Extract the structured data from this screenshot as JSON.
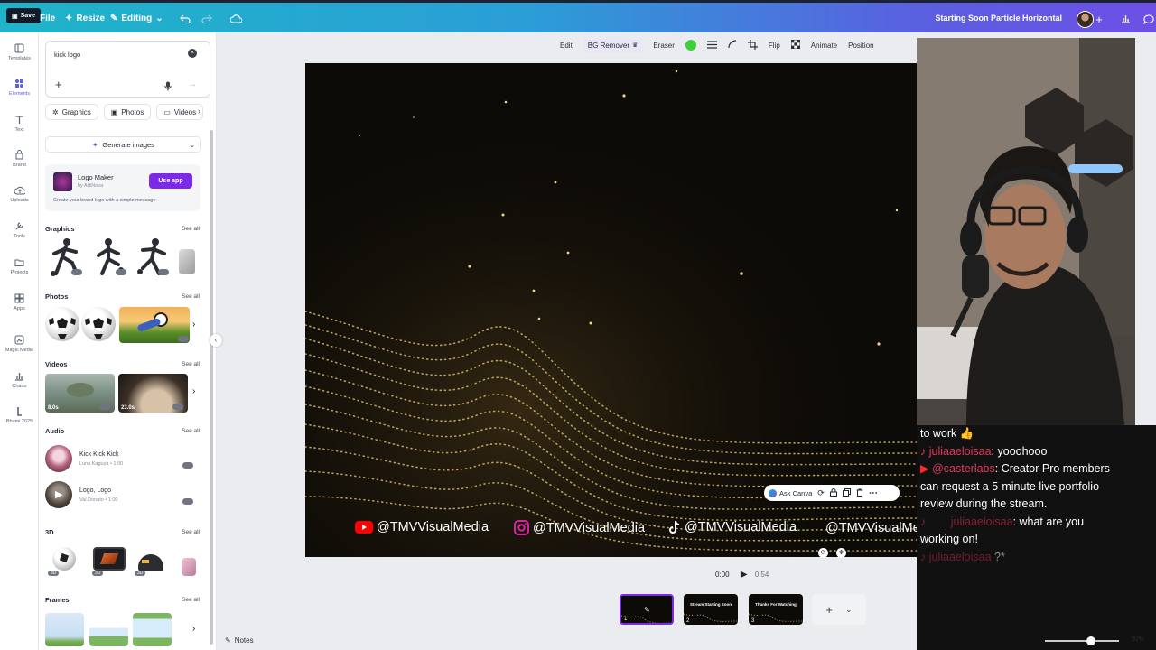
{
  "topbar": {
    "save_label": "Save",
    "file_label": "File",
    "resize_label": "Resize",
    "editing_label": "Editing",
    "project_title": "Starting Soon Particle Horizontal",
    "icons": [
      "undo-icon",
      "redo-icon",
      "cloud-sync-icon",
      "add-icon",
      "analytics-icon",
      "comment-icon"
    ]
  },
  "rail": {
    "items": [
      {
        "label": "Templates",
        "icon": "templates-icon"
      },
      {
        "label": "Elements",
        "icon": "elements-icon"
      },
      {
        "label": "Text",
        "icon": "text-icon"
      },
      {
        "label": "Brand",
        "icon": "brand-icon"
      },
      {
        "label": "Uploads",
        "icon": "uploads-icon"
      },
      {
        "label": "Tools",
        "icon": "tools-icon"
      },
      {
        "label": "Projects",
        "icon": "projects-icon"
      },
      {
        "label": "Apps",
        "icon": "apps-icon"
      },
      {
        "label": "Magic Media",
        "icon": "magic-media-icon"
      },
      {
        "label": "Charts",
        "icon": "charts-icon"
      },
      {
        "label": "Bhumi 2025",
        "icon": "bhumi-icon"
      }
    ],
    "active_color": "#5b5fe0"
  },
  "panel": {
    "search_value": "kick logo",
    "tabs": [
      "Graphics",
      "Photos",
      "Videos"
    ],
    "generate_label": "Generate images",
    "logo_maker": {
      "title": "Logo Maker",
      "by": "by ArtiNova",
      "desc": "Create your brand logo with a simple message",
      "button": "Use app"
    },
    "sections": {
      "graphics": "Graphics",
      "photos": "Photos",
      "videos": "Videos",
      "audio": "Audio",
      "three_d": "3D",
      "frames": "Frames"
    },
    "see_all": "See all",
    "video_durations": [
      "8.0s",
      "23.0s"
    ],
    "audio": [
      {
        "title": "Kick Kick Kick",
        "artist": "Luna Kaguya • 1:00"
      },
      {
        "title": "Logo, Logo",
        "artist": "Val.Donato • 1:00"
      }
    ]
  },
  "toolbar": {
    "items": [
      "Edit",
      "BG Remover",
      "Eraser",
      "Flip",
      "Animate",
      "Position"
    ],
    "fill_color": "#3ecf3e"
  },
  "canvas": {
    "socials": [
      {
        "icon": "youtube-icon",
        "handle": "@TMVVisualMedia"
      },
      {
        "icon": "instagram-icon",
        "handle": "@TMVVisualMedia"
      },
      {
        "icon": "tiktok-icon",
        "handle": "@TMVVisualMedia"
      },
      {
        "icon": "kick-icon",
        "handle": "@TMVVisualMedia"
      }
    ],
    "ask_canva": "Ask Canva"
  },
  "chat": {
    "lines": [
      {
        "user": "",
        "text": "to work 👍"
      },
      {
        "user": "juliaaeloisaa",
        "text": ": yooohooo"
      },
      {
        "user": "@casterlabs",
        "text": ": Creator Pro members"
      },
      {
        "user": "",
        "text": "can request a 5-minute live portfolio"
      },
      {
        "user": "",
        "text": "review during the stream."
      },
      {
        "user": "juliaaeloisaa",
        "text": ": what are you"
      },
      {
        "user": "",
        "text": "working on!"
      },
      {
        "user": "juliaaeloisaa",
        "text": " ?*"
      }
    ]
  },
  "timeline": {
    "current": "0:00",
    "total": "0:54",
    "pages": [
      {
        "num": "1",
        "title": ""
      },
      {
        "num": "2",
        "title": "Stream Starting Soon"
      },
      {
        "num": "3",
        "title": "Thanks For Watching"
      }
    ]
  },
  "footer": {
    "notes_label": "Notes",
    "zoom": "92%"
  }
}
